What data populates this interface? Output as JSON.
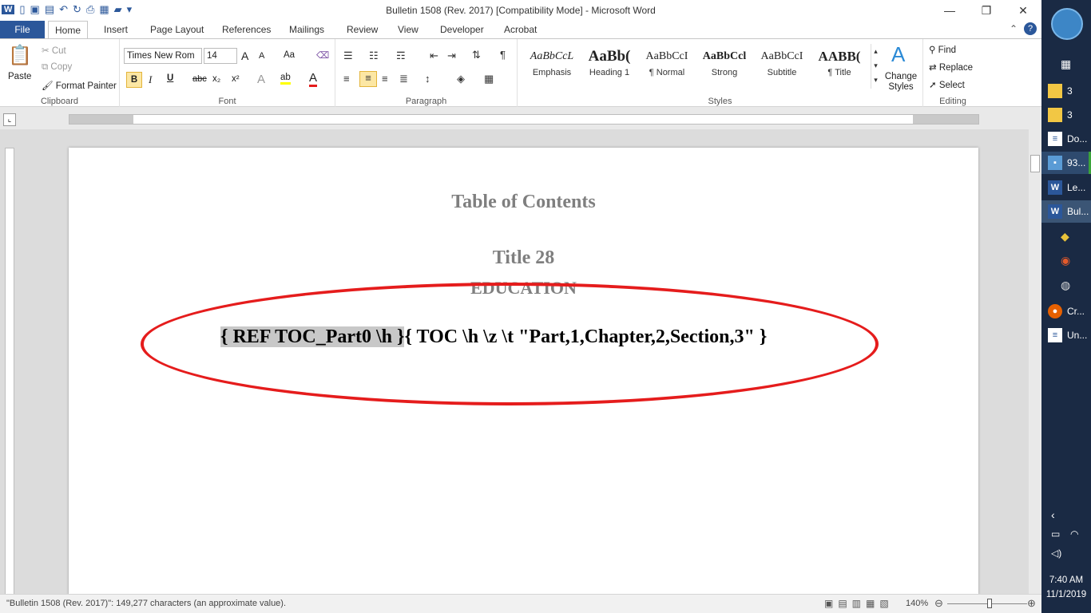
{
  "window": {
    "title": "Bulletin 1508 (Rev. 2017) [Compatibility Mode]  -  Microsoft Word"
  },
  "tabs": [
    "File",
    "Home",
    "Insert",
    "Page Layout",
    "References",
    "Mailings",
    "Review",
    "View",
    "Developer",
    "Acrobat"
  ],
  "clipboard": {
    "paste": "Paste",
    "cut": "Cut",
    "copy": "Copy",
    "format_painter": "Format Painter",
    "label": "Clipboard"
  },
  "font": {
    "name": "Times New Rom",
    "size": "14",
    "label": "Font",
    "bold": "B",
    "italic": "I",
    "underline": "U",
    "strike": "abc",
    "sub": "x₂",
    "sup": "x²",
    "grow": "A",
    "shrink": "A",
    "case": "Aa"
  },
  "paragraph": {
    "label": "Paragraph"
  },
  "styles": {
    "label": "Styles",
    "items": [
      {
        "preview": "AaBbCcL",
        "name": "Emphasis"
      },
      {
        "preview": "AaBb(",
        "name": "Heading 1"
      },
      {
        "preview": "AaBbCcI",
        "name": "¶ Normal"
      },
      {
        "preview": "AaBbCcl",
        "name": "Strong"
      },
      {
        "preview": "AaBbCcI",
        "name": "Subtitle"
      },
      {
        "preview": "AABB(",
        "name": "¶ Title"
      }
    ],
    "change": "Change Styles"
  },
  "editing": {
    "find": "Find",
    "replace": "Replace",
    "select": "Select",
    "label": "Editing"
  },
  "document": {
    "toc_heading": "Table of Contents",
    "title": "Title 28",
    "subtitle": "EDUCATION",
    "field_ref": "{ REF TOC_Part0 \\h  }",
    "field_toc": "{ TOC \\h \\z \\t \"Part,1,Chapter,2,Section,3\" }"
  },
  "status": {
    "text": "\"Bulletin 1508 (Rev. 2017)\": 149,277 characters (an approximate value).",
    "zoom": "140%"
  },
  "taskbar": {
    "items": [
      {
        "label": "3"
      },
      {
        "label": "3"
      },
      {
        "label": "Do..."
      },
      {
        "label": "93..."
      },
      {
        "label": "Le..."
      },
      {
        "label": "Bul..."
      },
      {
        "label": "Cr..."
      },
      {
        "label": "Un..."
      }
    ],
    "time": "7:40 AM",
    "date": "11/1/2019"
  }
}
